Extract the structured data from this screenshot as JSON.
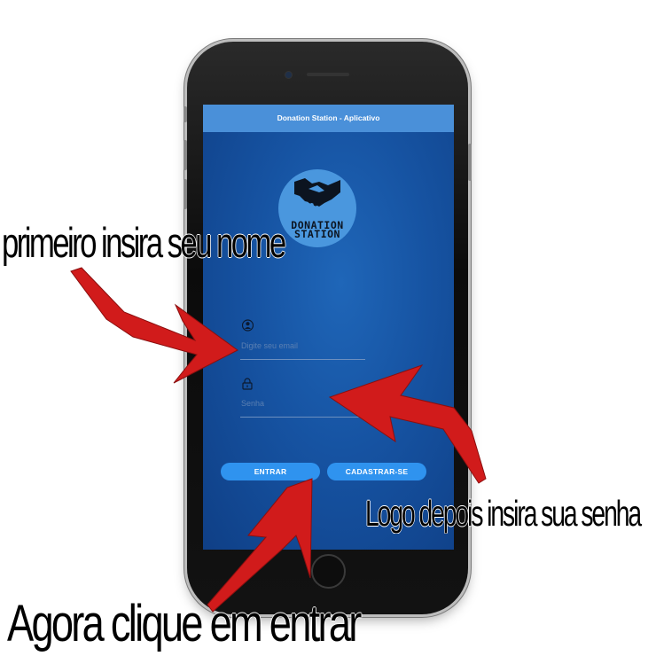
{
  "app": {
    "title": "Donation Station - Aplicativo",
    "logo_line1": "DONATION",
    "logo_line2": "STATION"
  },
  "login": {
    "email_placeholder": "Digite seu email",
    "password_placeholder": "Senha",
    "enter_label": "ENTRAR",
    "register_label": "CADASTRAR-SE"
  },
  "annotations": {
    "step1": "primeiro insira seu nome",
    "step2": "Logo depois insira sua senha",
    "step3": "Agora clique em entrar"
  },
  "colors": {
    "app_bar": "#4a90d9",
    "screen_bg": "#1653a2",
    "button": "#2f93ef",
    "arrow": "#d11b1b"
  },
  "icons": [
    "user-icon",
    "lock-icon",
    "handshake-icon"
  ]
}
